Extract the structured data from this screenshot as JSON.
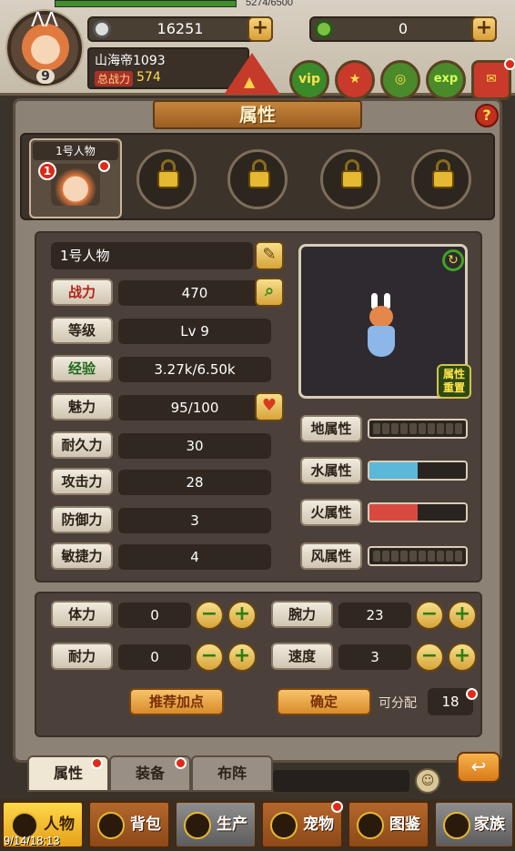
{
  "header": {
    "hp_text": "5274/6500",
    "silver": "16251",
    "gems": "0",
    "player_name": "山海帝1093",
    "power_label": "总战力",
    "power_value": "574",
    "level": "9",
    "icons": [
      "vip-icon",
      "star-icon",
      "gift-icon",
      "exp-icon",
      "mail-icon"
    ],
    "icon_labels": {
      "vip": "vip",
      "exp": "exp"
    }
  },
  "panel": {
    "title": "属性",
    "help": "?"
  },
  "characters": {
    "slot1_label": "1号人物",
    "slot1_badge": "1",
    "locked_slots": 4
  },
  "stats": {
    "name_value": "1号人物",
    "rows": [
      {
        "label": "战力",
        "value": "470"
      },
      {
        "label": "等级",
        "value": "Lv 9"
      },
      {
        "label": "经验",
        "value": "3.27k/6.50k"
      },
      {
        "label": "魅力",
        "value": "95/100"
      },
      {
        "label": "耐久力",
        "value": "30"
      },
      {
        "label": "攻击力",
        "value": "28"
      },
      {
        "label": "防御力",
        "value": "3"
      },
      {
        "label": "敏捷力",
        "value": "4"
      }
    ]
  },
  "preview": {
    "reset_label": "属性重置"
  },
  "elements": [
    {
      "label": "地属性",
      "level": 0,
      "color": "#554a40"
    },
    {
      "label": "水属性",
      "level": 0.5,
      "color": "#5bb8d8"
    },
    {
      "label": "火属性",
      "level": 0.5,
      "color": "#d84a40"
    },
    {
      "label": "风属性",
      "level": 0,
      "color": "#554a40"
    }
  ],
  "allocation": {
    "rows": [
      {
        "label": "体力",
        "value": "0"
      },
      {
        "label": "腕力",
        "value": "23"
      },
      {
        "label": "耐力",
        "value": "0"
      },
      {
        "label": "速度",
        "value": "3"
      }
    ],
    "recommend_label": "推荐加点",
    "confirm_label": "确定",
    "available_label": "可分配",
    "available_value": "18",
    "minus": "−",
    "plus": "+"
  },
  "tabs": [
    "属性",
    "装备",
    "布阵"
  ],
  "back_symbol": "↩",
  "nav": [
    {
      "label": "人物"
    },
    {
      "label": "背包"
    },
    {
      "label": "生产"
    },
    {
      "label": "宠物"
    },
    {
      "label": "图鉴"
    },
    {
      "label": "家族"
    }
  ],
  "timestamp": "9/14/18:13"
}
